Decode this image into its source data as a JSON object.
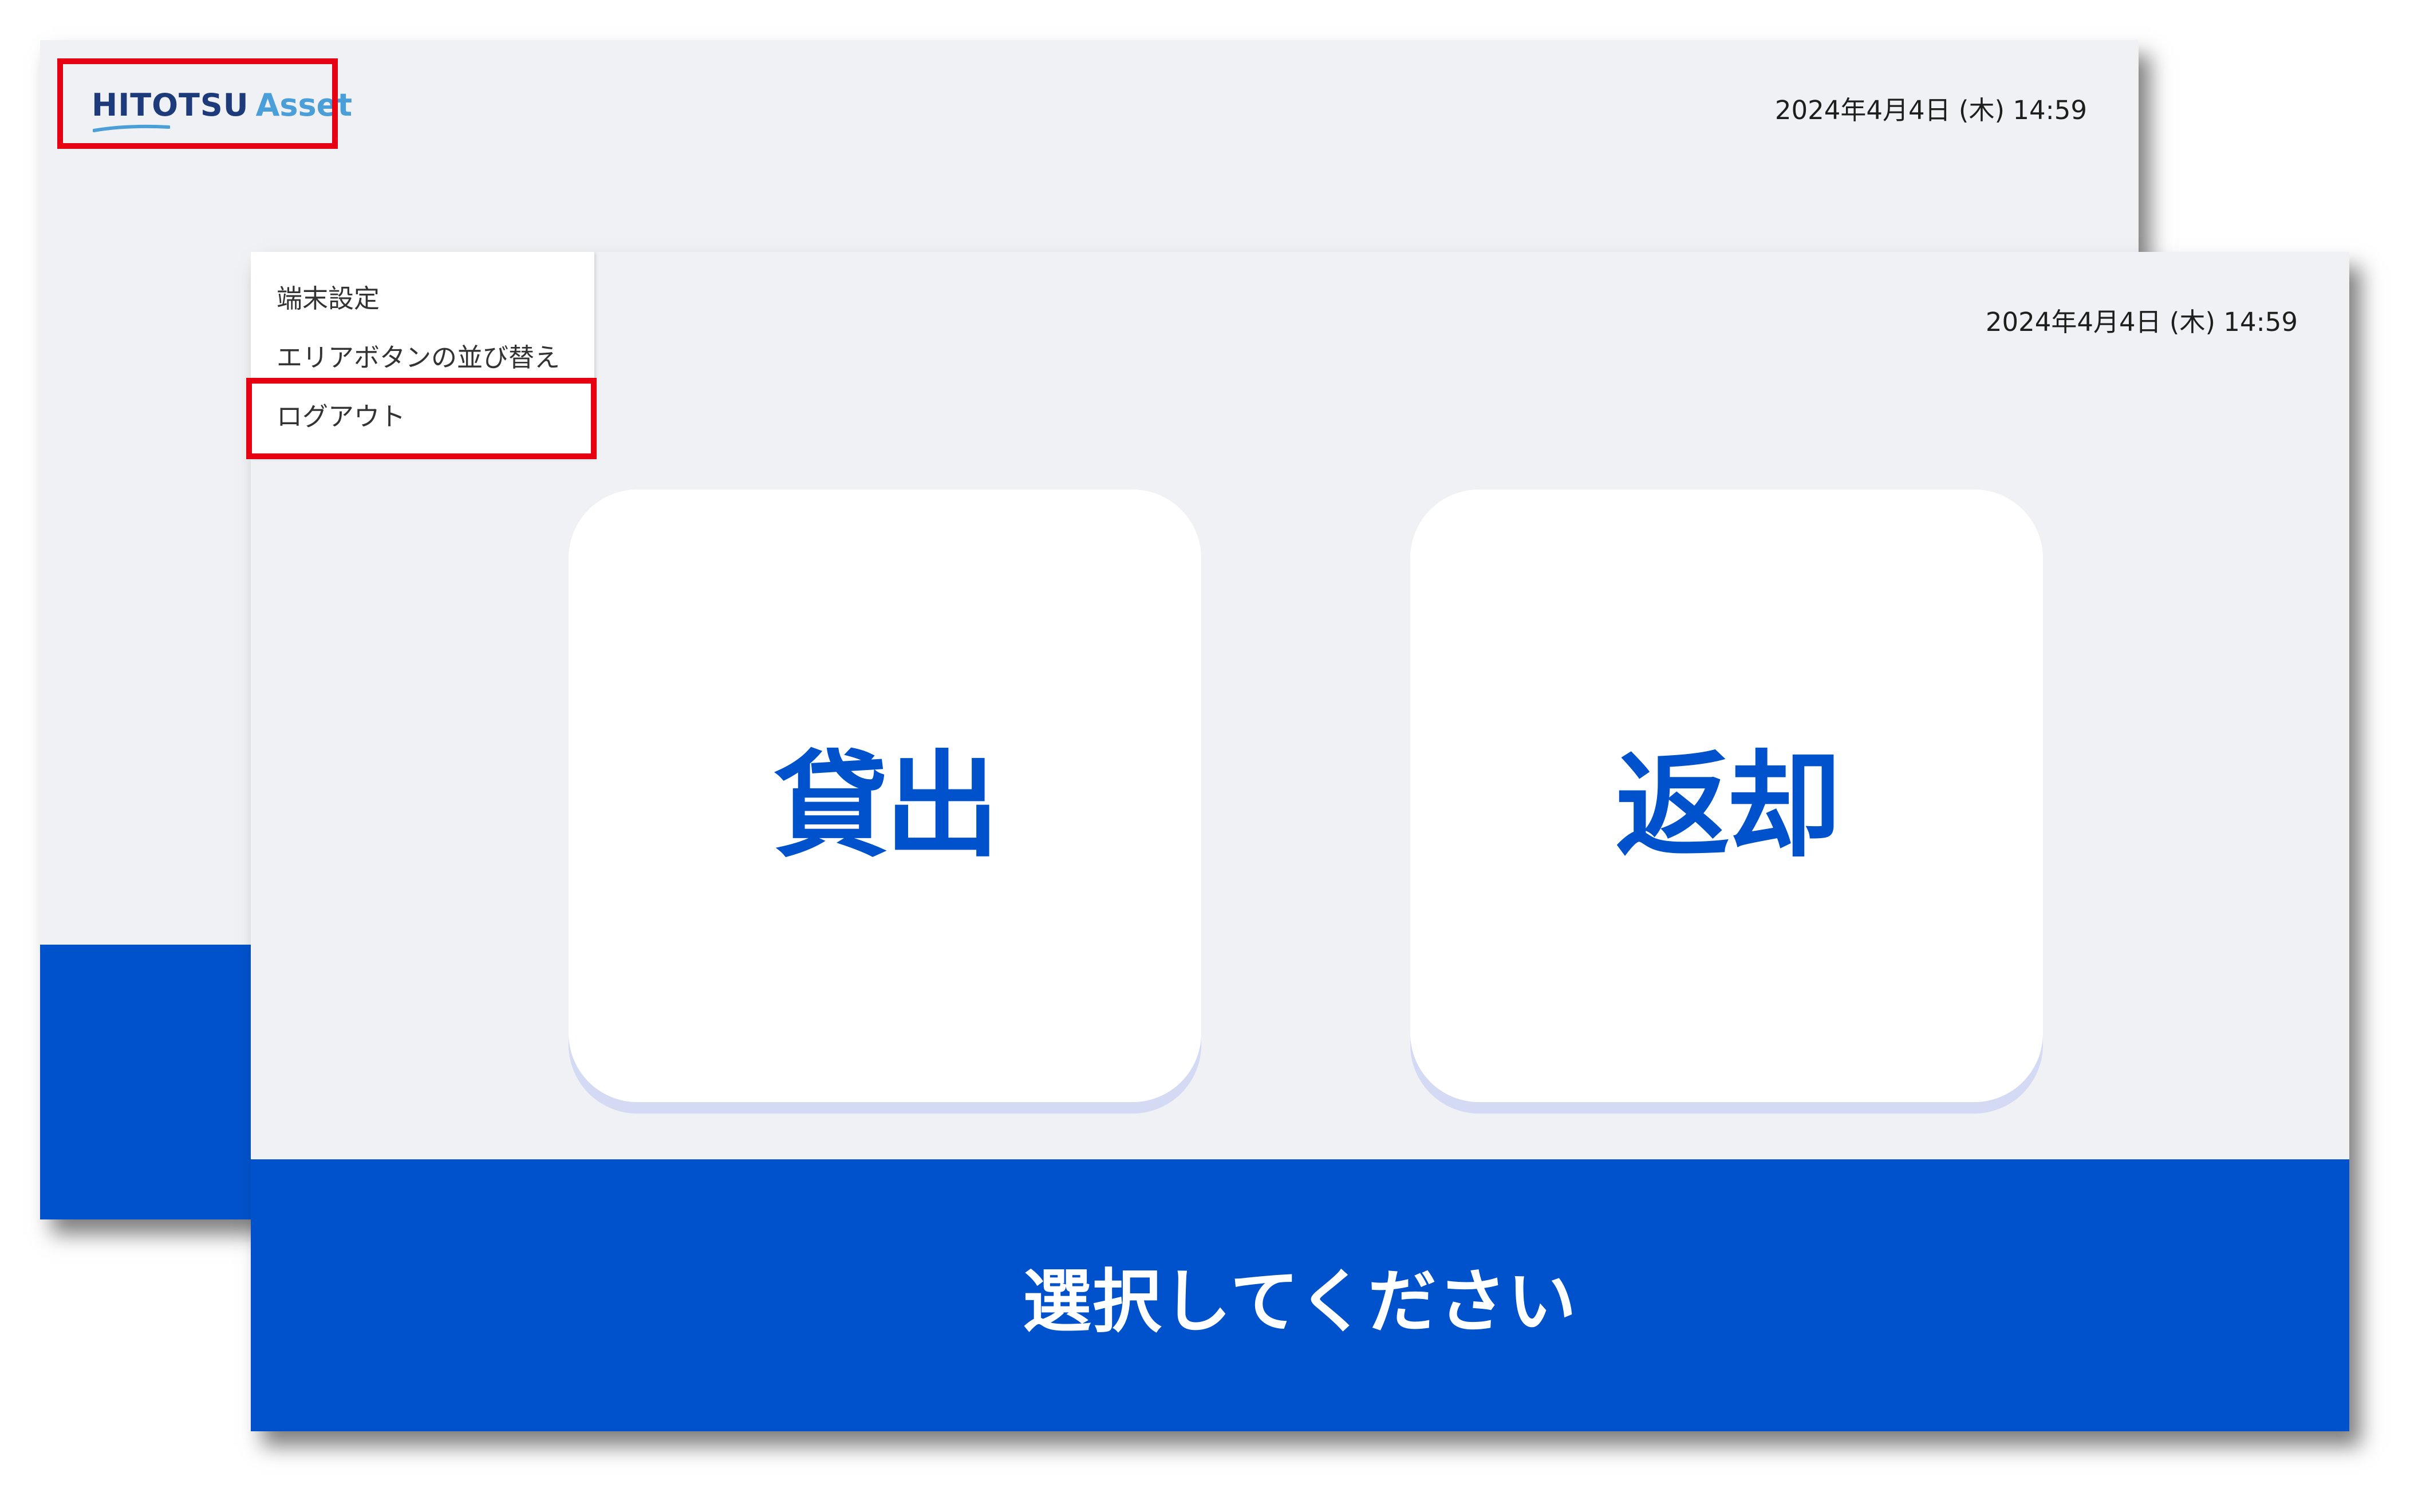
{
  "back_screen": {
    "logo": {
      "primary": "HITOTSU",
      "secondary": "Asset"
    },
    "datetime": "2024年4月4日 (木) 14:59"
  },
  "front_screen": {
    "datetime": "2024年4月4日 (木) 14:59",
    "menu": {
      "items": [
        {
          "label": "端末設定"
        },
        {
          "label": "エリアボタンの並び替え"
        },
        {
          "label": "ログアウト"
        }
      ]
    },
    "tiles": {
      "lend_label": "貸出",
      "return_label": "返却"
    },
    "footer": {
      "prompt": "選択してください"
    }
  },
  "colors": {
    "brand_blue": "#0052cc",
    "logo_navy": "#1d3b7a",
    "logo_light_blue": "#4a9fd8",
    "screen_background": "#f0f1f4",
    "highlight_red": "#e60012",
    "tile_shadow": "#d4daf3"
  },
  "annotations": [
    {
      "target": "logo",
      "style": "red-outline"
    },
    {
      "target": "logout-menu-item",
      "style": "red-outline"
    }
  ]
}
